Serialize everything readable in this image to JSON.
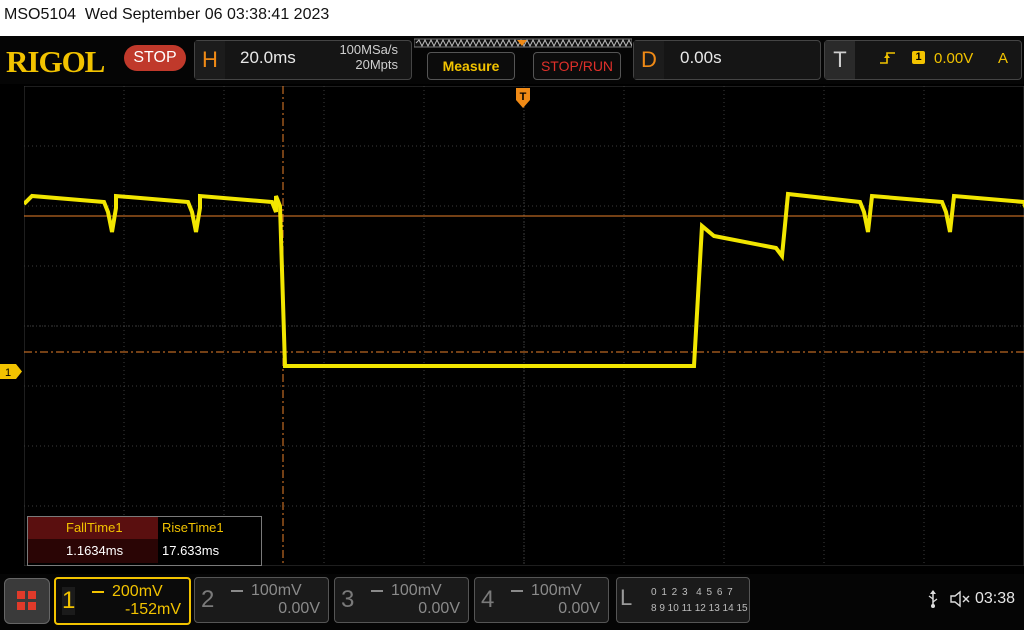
{
  "title_bar": {
    "text": "MSO5104  Wed September 06 03:38:41 2023"
  },
  "brand": {
    "logo": "RIGOL",
    "run_status": "STOP"
  },
  "horizontal": {
    "key": "H",
    "timebase": "20.0ms",
    "sample_rate": "100MSa/s",
    "memory_depth": "20Mpts"
  },
  "buttons": {
    "measure": "Measure",
    "stop_run": "STOP/RUN"
  },
  "delay": {
    "key": "D",
    "value": "0.00s"
  },
  "trigger": {
    "key": "T",
    "source": "1",
    "level": "0.00V",
    "mode": "A"
  },
  "channel_marker": "1",
  "trigger_pos_marker": "T",
  "measurements": {
    "fall_label": "FallTime1",
    "fall_value": "1.1634ms",
    "rise_label": "RiseTime1",
    "rise_value": "17.633ms"
  },
  "channels": [
    {
      "num": "1",
      "scale": "200mV",
      "offset": "-152mV",
      "active": true
    },
    {
      "num": "2",
      "scale": "100mV",
      "offset": "0.00V",
      "active": false
    },
    {
      "num": "3",
      "scale": "100mV",
      "offset": "0.00V",
      "active": false
    },
    {
      "num": "4",
      "scale": "100mV",
      "offset": "0.00V",
      "active": false
    }
  ],
  "logic": {
    "key": "L",
    "row1": "0 1 2 3  4 5 6 7",
    "row2": "8 9 10 11 12 13 14 15"
  },
  "status": {
    "clock": "03:38"
  },
  "icons": {
    "usb": "usb-icon",
    "speaker": "speaker-muted-icon",
    "menu": "menu-grid-icon"
  },
  "colors": {
    "ch1": "#f2c300",
    "accent_orange": "#f08a16",
    "stop_red": "#c0392b",
    "cursor_line": "#e8802a"
  }
}
